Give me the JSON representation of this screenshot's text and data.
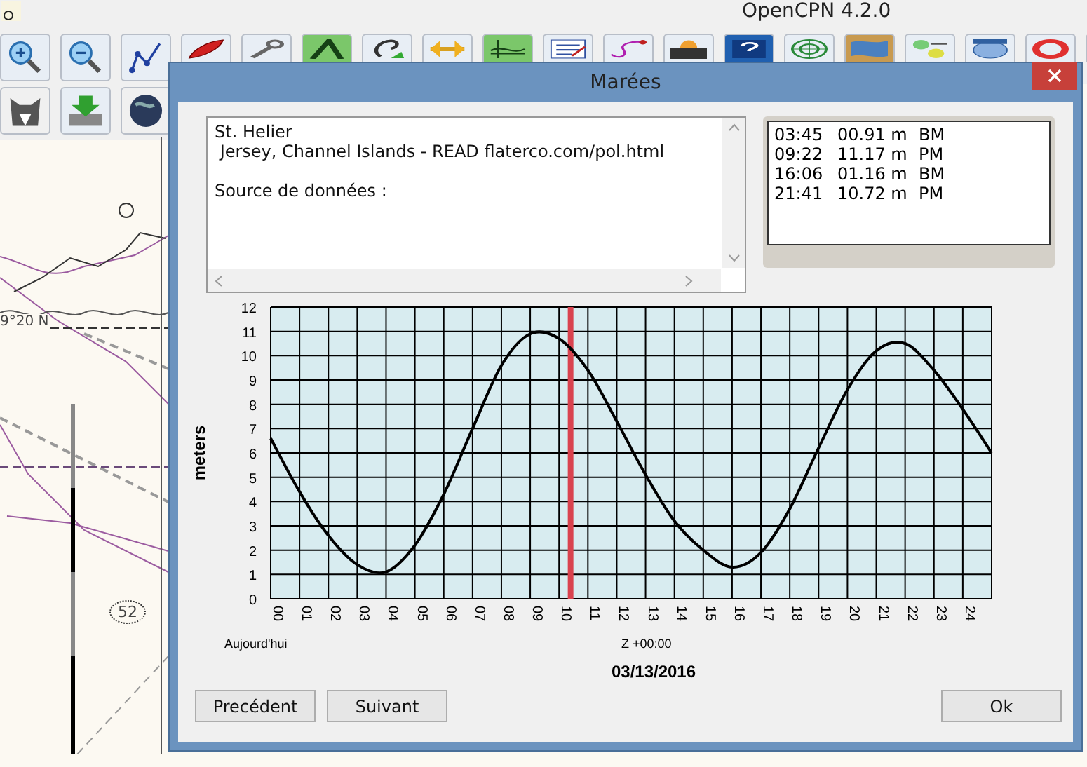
{
  "app": {
    "title": "OpenCPN 4.2.0"
  },
  "map_labels": [
    "9°20 N",
    "52"
  ],
  "dialog": {
    "title": "Marées",
    "station": "St. Helier",
    "location": " Jersey, Channel Islands - READ flaterco.com/pol.html",
    "source_label": "Source de données :",
    "tide_events": [
      {
        "time": "03:45",
        "height": "00.91 m",
        "type": "BM"
      },
      {
        "time": "09:22",
        "height": "11.17 m",
        "type": "PM"
      },
      {
        "time": "16:06",
        "height": "01.16 m",
        "type": "BM"
      },
      {
        "time": "21:41",
        "height": "10.72 m",
        "type": "PM"
      }
    ],
    "chart": {
      "chart_data": {
        "type": "line",
        "ylabel": "meters",
        "x": [
          0,
          1,
          2,
          3,
          4,
          5,
          6,
          7,
          8,
          9,
          10,
          11,
          12,
          13,
          14,
          15,
          16,
          17,
          18,
          19,
          20,
          21,
          22,
          23,
          24,
          25
        ],
        "series": [
          {
            "color": "#000000",
            "values": [
              6.6,
              4.4,
              2.6,
              1.4,
              1.1,
              2.2,
              4.3,
              7.0,
              9.6,
              10.9,
              10.7,
              9.4,
              7.3,
              5.1,
              3.2,
              2.0,
              1.3,
              1.9,
              3.7,
              6.2,
              8.6,
              10.2,
              10.5,
              9.4,
              7.8,
              6.0
            ]
          }
        ],
        "xlim": [
          0,
          25
        ],
        "ylim": [
          0,
          12
        ],
        "xticks": [
          {
            "value": 0,
            "label": "00"
          },
          {
            "value": 1,
            "label": "01"
          },
          {
            "value": 2,
            "label": "02"
          },
          {
            "value": 3,
            "label": "03"
          },
          {
            "value": 4,
            "label": "04"
          },
          {
            "value": 5,
            "label": "05"
          },
          {
            "value": 6,
            "label": "06"
          },
          {
            "value": 7,
            "label": "07"
          },
          {
            "value": 8,
            "label": "08"
          },
          {
            "value": 9,
            "label": "09"
          },
          {
            "value": 10,
            "label": "10"
          },
          {
            "value": 11,
            "label": "11"
          },
          {
            "value": 12,
            "label": "12"
          },
          {
            "value": 13,
            "label": "13"
          },
          {
            "value": 14,
            "label": "14"
          },
          {
            "value": 15,
            "label": "15"
          },
          {
            "value": 16,
            "label": "16"
          },
          {
            "value": 17,
            "label": "17"
          },
          {
            "value": 18,
            "label": "18"
          },
          {
            "value": 19,
            "label": "19"
          },
          {
            "value": 20,
            "label": "20"
          },
          {
            "value": 21,
            "label": "21"
          },
          {
            "value": 22,
            "label": "22"
          },
          {
            "value": 23,
            "label": "23"
          },
          {
            "value": 24,
            "label": "24"
          }
        ],
        "yticks": [
          0,
          1,
          2,
          3,
          4,
          5,
          6,
          7,
          8,
          9,
          10,
          11,
          12
        ],
        "grid": true,
        "ref_lines": [
          {
            "axis": "x",
            "value": 10.4,
            "color": "#d9434f"
          }
        ]
      },
      "day_label": "Aujourd'hui",
      "timezone": "Z +00:00",
      "date": "03/13/2016"
    },
    "buttons": [
      {
        "label": "Precédent"
      },
      {
        "label": "Suivant"
      },
      {
        "label": "Ok"
      }
    ]
  }
}
